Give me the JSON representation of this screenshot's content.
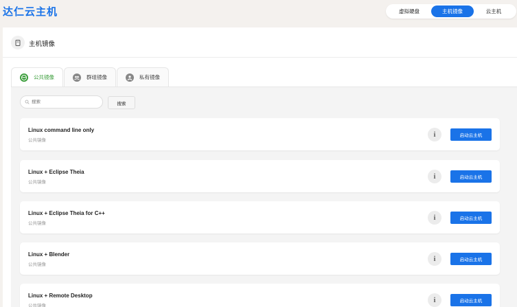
{
  "app": {
    "title": "达仁云主机"
  },
  "nav": {
    "items": [
      {
        "label": "虚拟硬盘",
        "active": false
      },
      {
        "label": "主机镜像",
        "active": true
      },
      {
        "label": "云主机",
        "active": false
      }
    ]
  },
  "page": {
    "title": "主机镜像",
    "icon": "image-file-icon"
  },
  "tabs": [
    {
      "label": "公共镜像",
      "icon": "globe-icon",
      "active": true
    },
    {
      "label": "群组镜像",
      "icon": "group-icon",
      "active": false
    },
    {
      "label": "私有镜像",
      "icon": "user-icon",
      "active": false
    }
  ],
  "search": {
    "placeholder": "搜索",
    "value": "",
    "button_label": "搜索"
  },
  "images": [
    {
      "name": "Linux command line only",
      "type": "公共镜像",
      "action_label": "启动云主机"
    },
    {
      "name": "Linux + Eclipse Theia",
      "type": "公共镜像",
      "action_label": "启动云主机"
    },
    {
      "name": "Linux + Eclipse Theia for C++",
      "type": "公共镜像",
      "action_label": "启动云主机"
    },
    {
      "name": "Linux + Blender",
      "type": "公共镜像",
      "action_label": "启动云主机"
    },
    {
      "name": "Linux + Remote Desktop",
      "type": "公共镜像",
      "action_label": "启动云主机"
    }
  ],
  "colors": {
    "accent": "#1a73e8",
    "active_tab": "#3a9d3a",
    "background": "#f4f1ee"
  }
}
